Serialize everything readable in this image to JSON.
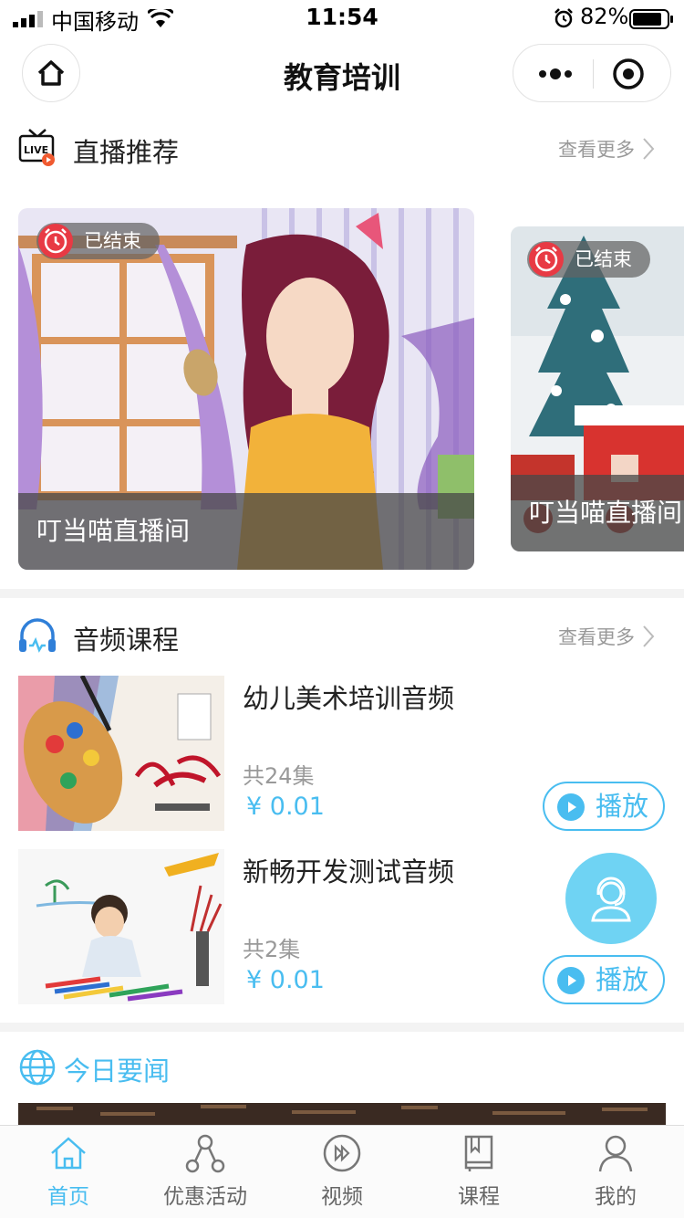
{
  "status_bar": {
    "carrier": "中国移动",
    "time": "11:54",
    "battery": "82%"
  },
  "nav": {
    "title": "教育培训"
  },
  "live_section": {
    "title": "直播推荐",
    "more": "查看更多",
    "cards": [
      {
        "status": "已结束",
        "name": "叮当喵直播间"
      },
      {
        "status": "已结束",
        "name": "叮当喵直播间"
      }
    ]
  },
  "audio_section": {
    "title": "音频课程",
    "more": "查看更多",
    "items": [
      {
        "title": "幼儿美术培训音频",
        "count": "共24集",
        "price": "¥ 0.01",
        "play": "播放"
      },
      {
        "title": "新畅开发测试音频",
        "count": "共2集",
        "price": "¥ 0.01",
        "play": "播放"
      }
    ]
  },
  "news_section": {
    "title": "今日要闻"
  },
  "tabs": [
    {
      "label": "首页",
      "icon": "home-icon",
      "active": true
    },
    {
      "label": "优惠活动",
      "icon": "share-icon",
      "active": false
    },
    {
      "label": "视频",
      "icon": "video-icon",
      "active": false
    },
    {
      "label": "课程",
      "icon": "book-icon",
      "active": false
    },
    {
      "label": "我的",
      "icon": "user-icon",
      "active": false
    }
  ],
  "colors": {
    "accent": "#49bdf0",
    "badge_red": "#e83a44",
    "float_button": "#6fd3f3"
  }
}
